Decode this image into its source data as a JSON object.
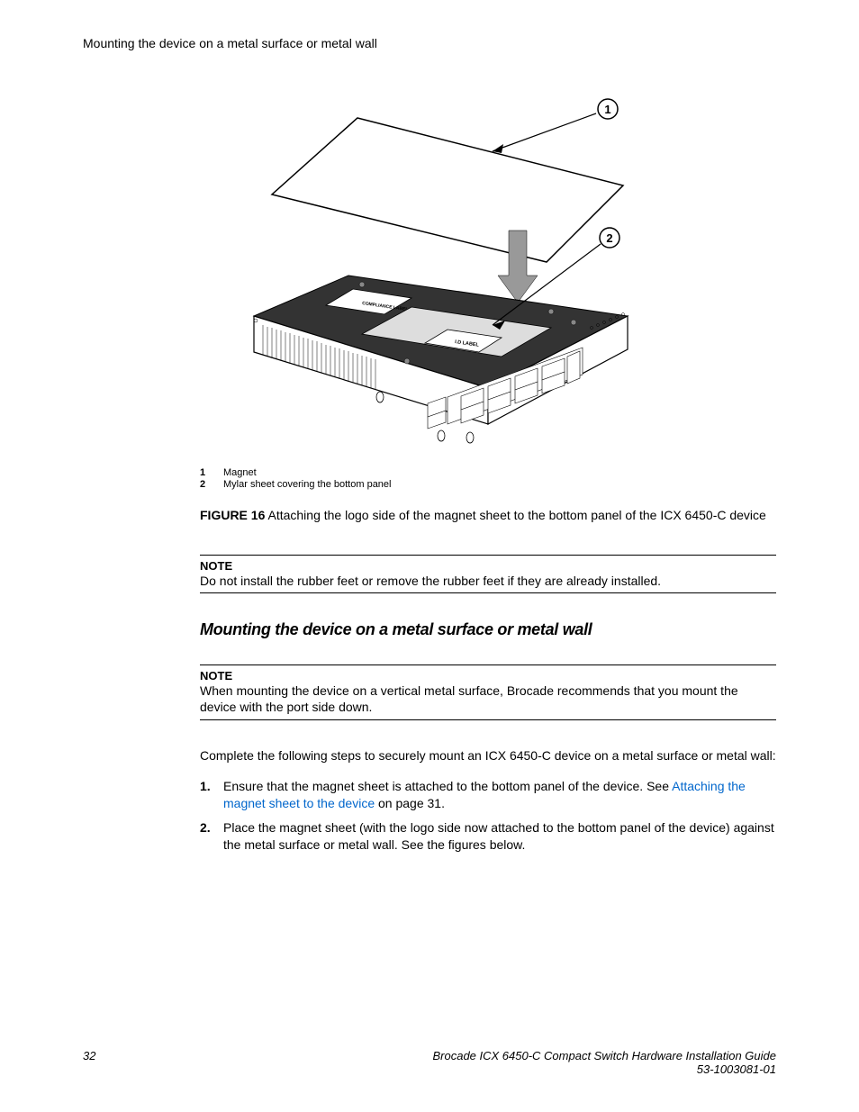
{
  "header": {
    "running_head": "Mounting the device on a metal surface or metal wall"
  },
  "figure": {
    "callout_1": "1",
    "callout_2": "2",
    "label_compliance": "COMPLIANCE LABEL",
    "label_id": "I.D LABEL"
  },
  "legend": {
    "row1_num": "1",
    "row1_text": "Magnet",
    "row2_num": "2",
    "row2_text": "Mylar sheet covering the bottom panel"
  },
  "figure_caption": {
    "prefix": "FIGURE 16",
    "text": " Attaching the logo side of the magnet sheet to the bottom panel of the ICX 6450-C device"
  },
  "note1": {
    "title": "NOTE",
    "body": "Do not install the rubber feet or remove the rubber feet if they are already installed."
  },
  "section_heading": "Mounting the device on a metal surface or metal wall",
  "note2": {
    "title": "NOTE",
    "body": "When mounting the device on a vertical metal surface, Brocade recommends that you mount the device with the port side down."
  },
  "intro": "Complete the following steps to securely mount an ICX 6450-C device on a metal surface or metal wall:",
  "steps": {
    "s1_a": "Ensure that the magnet sheet is attached to the bottom panel of the device. See ",
    "s1_link": "Attaching the magnet sheet to the device",
    "s1_b": " on page 31.",
    "s2": "Place the magnet sheet (with the logo side now attached to the bottom panel of the device) against the metal surface or metal wall. See the figures below."
  },
  "footer": {
    "page_num": "32",
    "doc_title": "Brocade ICX 6450-C Compact Switch Hardware Installation Guide",
    "doc_id": "53-1003081-01"
  }
}
